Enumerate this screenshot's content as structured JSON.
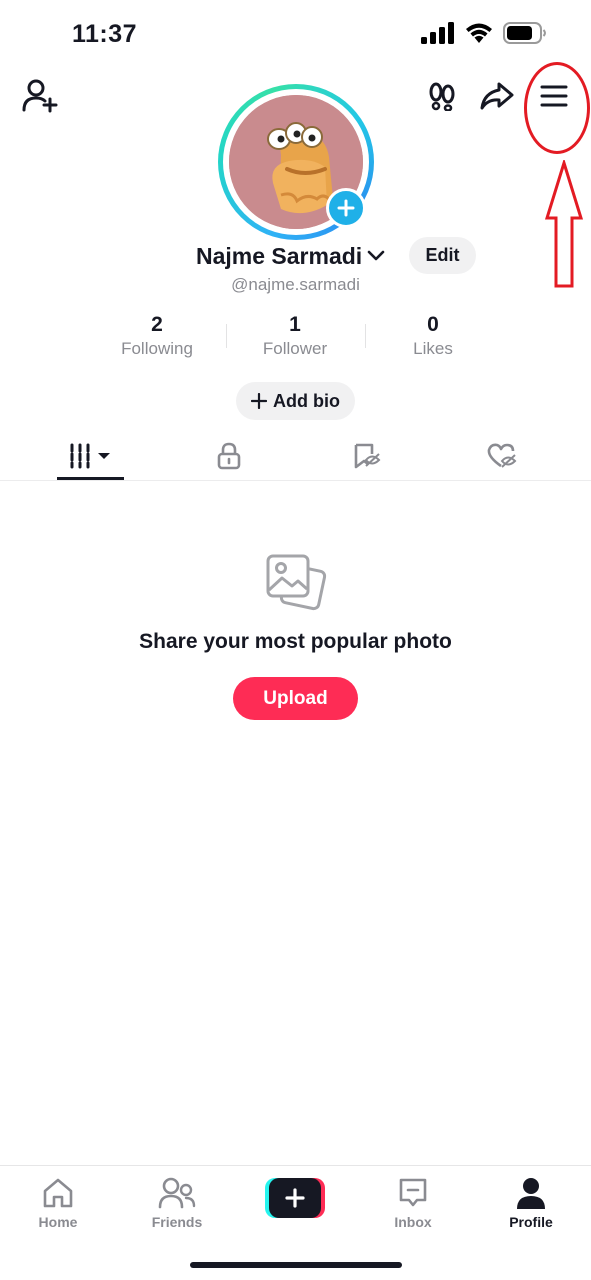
{
  "status_bar": {
    "time": "11:37"
  },
  "profile": {
    "name": "Najme Sarmadi",
    "handle": "@najme.sarmadi",
    "edit_label": "Edit",
    "add_bio_label": "Add bio",
    "stats": [
      {
        "value": "2",
        "label": "Following"
      },
      {
        "value": "1",
        "label": "Follower"
      },
      {
        "value": "0",
        "label": "Likes"
      }
    ]
  },
  "tabs": [
    {
      "icon": "grid-icon",
      "active": true
    },
    {
      "icon": "lock-icon",
      "active": false
    },
    {
      "icon": "bookmark-hidden-icon",
      "active": false
    },
    {
      "icon": "liked-hidden-icon",
      "active": false
    }
  ],
  "empty_state": {
    "title": "Share your most popular photo",
    "upload_label": "Upload"
  },
  "bottom_nav": [
    {
      "label": "Home",
      "icon": "home-icon"
    },
    {
      "label": "Friends",
      "icon": "friends-icon"
    },
    {
      "label": "",
      "icon": "create-plus-icon"
    },
    {
      "label": "Inbox",
      "icon": "inbox-icon"
    },
    {
      "label": "Profile",
      "icon": "profile-icon",
      "active": true
    }
  ],
  "colors": {
    "accent": "#fe2c55",
    "ring": "#2fb3f5",
    "annotation": "#e31b23",
    "text_primary": "#161823",
    "text_secondary": "#8a8b91"
  }
}
